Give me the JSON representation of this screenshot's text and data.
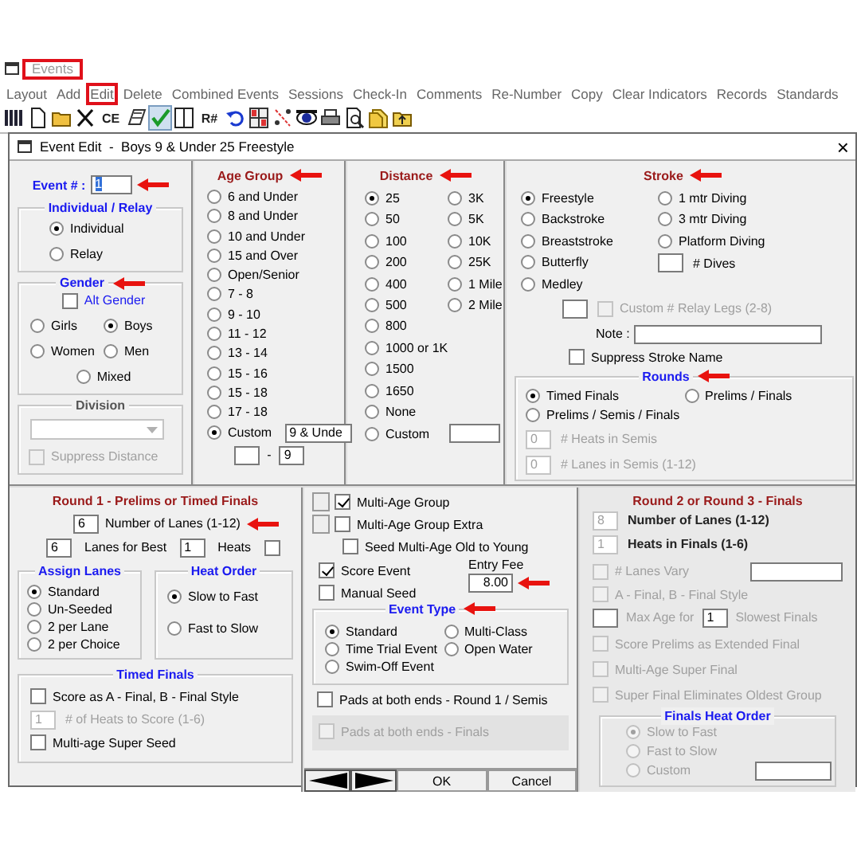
{
  "window": {
    "title": "Events",
    "highlighted": true
  },
  "menu": [
    {
      "label": "Layout",
      "highlighted": false
    },
    {
      "label": "Add",
      "highlighted": false
    },
    {
      "label": "Edit",
      "highlighted": true
    },
    {
      "label": "Delete",
      "highlighted": false
    },
    {
      "label": "Combined Events",
      "highlighted": false
    },
    {
      "label": "Sessions",
      "highlighted": false
    },
    {
      "label": "Check-In",
      "highlighted": false
    },
    {
      "label": "Comments",
      "highlighted": false
    },
    {
      "label": "Re-Number",
      "highlighted": false
    },
    {
      "label": "Copy",
      "highlighted": false
    },
    {
      "label": "Clear Indicators",
      "highlighted": false
    },
    {
      "label": "Records",
      "highlighted": false
    },
    {
      "label": "Standards",
      "highlighted": false
    }
  ],
  "toolbar": [
    {
      "kind": "columns",
      "pressed": false
    },
    {
      "kind": "page",
      "pressed": false
    },
    {
      "kind": "folder",
      "pressed": false
    },
    {
      "kind": "cross",
      "pressed": false
    },
    {
      "kind": "text",
      "label": "CE",
      "pressed": false
    },
    {
      "kind": "book",
      "pressed": false
    },
    {
      "kind": "check",
      "pressed": true
    },
    {
      "kind": "split",
      "pressed": false
    },
    {
      "kind": "text",
      "label": "R#",
      "pressed": false
    },
    {
      "kind": "undo",
      "pressed": false
    },
    {
      "kind": "grid",
      "pressed": false
    },
    {
      "kind": "scatter",
      "pressed": false
    },
    {
      "kind": "eye",
      "pressed": false
    },
    {
      "kind": "printer",
      "pressed": false
    },
    {
      "kind": "preview",
      "pressed": false
    },
    {
      "kind": "folders",
      "pressed": false
    },
    {
      "kind": "upload",
      "pressed": false
    }
  ],
  "dialog": {
    "title": "Event Edit  -  Boys 9 & Under 25 Freestyle",
    "close": "×"
  },
  "event_number": {
    "label": "Event # :",
    "value": "1",
    "arrow": true
  },
  "individual_relay": {
    "title": "Individual / Relay",
    "options": [
      {
        "label": "Individual",
        "selected": true
      },
      {
        "label": "Relay",
        "selected": false
      }
    ]
  },
  "gender": {
    "title": "Gender",
    "arrow": true,
    "alt_gender": {
      "label": "Alt Gender",
      "checked": false
    },
    "options": [
      {
        "label": "Girls",
        "selected": false
      },
      {
        "label": "Boys",
        "selected": true
      },
      {
        "label": "Women",
        "selected": false
      },
      {
        "label": "Men",
        "selected": false
      },
      {
        "label": "Mixed",
        "selected": false
      }
    ]
  },
  "division": {
    "title": "Division",
    "suppress_distance": {
      "label": "Suppress Distance",
      "checked": false,
      "disabled": true
    }
  },
  "age_group": {
    "title": "Age Group",
    "arrow": true,
    "options": [
      {
        "label": "6 and Under",
        "selected": false
      },
      {
        "label": "8 and Under",
        "selected": false
      },
      {
        "label": "10 and Under",
        "selected": false
      },
      {
        "label": "15 and Over",
        "selected": false
      },
      {
        "label": "Open/Senior",
        "selected": false
      },
      {
        "label": "7 - 8",
        "selected": false
      },
      {
        "label": "9 - 10",
        "selected": false
      },
      {
        "label": "11 - 12",
        "selected": false
      },
      {
        "label": "13 - 14",
        "selected": false
      },
      {
        "label": "15 - 16",
        "selected": false
      },
      {
        "label": "15 - 18",
        "selected": false
      },
      {
        "label": "17 - 18",
        "selected": false
      },
      {
        "label": "Custom",
        "selected": true
      }
    ],
    "custom_value": "9 & Unde",
    "range_separator": "-",
    "range_high": "9"
  },
  "distance": {
    "title": "Distance",
    "arrow": true,
    "column_1": [
      {
        "label": "25",
        "selected": true
      },
      {
        "label": "50",
        "selected": false
      },
      {
        "label": "100",
        "selected": false
      },
      {
        "label": "200",
        "selected": false
      },
      {
        "label": "400",
        "selected": false
      },
      {
        "label": "500",
        "selected": false
      },
      {
        "label": "800",
        "selected": false
      },
      {
        "label": "1000 or 1K",
        "selected": false
      },
      {
        "label": "1500",
        "selected": false
      },
      {
        "label": "1650",
        "selected": false
      },
      {
        "label": "None",
        "selected": false
      },
      {
        "label": "Custom",
        "selected": false
      }
    ],
    "column_2": [
      {
        "label": "3K",
        "selected": false
      },
      {
        "label": "5K",
        "selected": false
      },
      {
        "label": "10K",
        "selected": false
      },
      {
        "label": "25K",
        "selected": false
      },
      {
        "label": "1 Mile",
        "selected": false
      },
      {
        "label": "2 Mile",
        "selected": false
      }
    ]
  },
  "stroke": {
    "title": "Stroke",
    "arrow": true,
    "column_1": [
      {
        "label": "Freestyle",
        "selected": true
      },
      {
        "label": "Backstroke",
        "selected": false
      },
      {
        "label": "Breaststroke",
        "selected": false
      },
      {
        "label": "Butterfly",
        "selected": false
      },
      {
        "label": "Medley",
        "selected": false
      }
    ],
    "column_2": [
      {
        "label": "1 mtr Diving",
        "selected": false
      },
      {
        "label": "3 mtr Diving",
        "selected": false
      },
      {
        "label": "Platform Diving",
        "selected": false
      }
    ],
    "dives_label": "# Dives",
    "relay_legs": {
      "label": "Custom # Relay Legs (2-8)",
      "checked": false,
      "disabled": true
    },
    "note_label": "Note :",
    "suppress_stroke_name": {
      "label": "Suppress Stroke Name",
      "checked": false
    }
  },
  "rounds": {
    "title": "Rounds",
    "arrow": true,
    "options": [
      {
        "label": "Timed Finals",
        "selected": true
      },
      {
        "label": "Prelims / Finals",
        "selected": false
      },
      {
        "label": "Prelims / Semis / Finals",
        "selected": false
      }
    ],
    "heats_in_semis": {
      "value": "0",
      "label": "# Heats in Semis",
      "disabled": true
    },
    "lanes_in_semis": {
      "value": "0",
      "label": "# Lanes in Semis (1-12)",
      "disabled": true
    }
  },
  "round_1": {
    "title": "Round 1 - Prelims or Timed Finals",
    "lanes": {
      "value": "6",
      "label": "Number of Lanes (1-12)",
      "arrow": true
    },
    "lanes_for_best": {
      "value": "6",
      "label": "Lanes for Best"
    },
    "heats": {
      "value": "1",
      "label": "Heats",
      "checked": false
    },
    "assign_lanes": {
      "title": "Assign Lanes",
      "options": [
        {
          "label": "Standard",
          "selected": true
        },
        {
          "label": "Un-Seeded",
          "selected": false
        },
        {
          "label": "2 per Lane",
          "selected": false
        },
        {
          "label": "2 per Choice",
          "selected": false
        }
      ]
    },
    "heat_order": {
      "title": "Heat Order",
      "options": [
        {
          "label": "Slow to Fast",
          "selected": true
        },
        {
          "label": "Fast to Slow",
          "selected": false
        }
      ]
    },
    "timed_finals": {
      "title": "Timed Finals",
      "score_as_a_final": {
        "label": "Score as A - Final, B - Final Style",
        "checked": false
      },
      "heats_to_score": {
        "value": "1",
        "label": "# of Heats to Score (1-6)",
        "disabled": true
      },
      "multi_age_super_seed": {
        "label": "Multi-age Super Seed",
        "checked": false
      }
    }
  },
  "options": {
    "multi_age_group": {
      "label": "Multi-Age Group",
      "checked": true
    },
    "multi_age_group_extra": {
      "label": "Multi-Age Group Extra",
      "checked": false
    },
    "seed_multi_age": {
      "label": "Seed Multi-Age Old to Young",
      "checked": false
    },
    "score_event": {
      "label": "Score Event",
      "checked": true
    },
    "manual_seed": {
      "label": "Manual Seed",
      "checked": false
    },
    "entry_fee": {
      "label": "Entry Fee",
      "value": "8.00",
      "arrow": true
    },
    "event_type": {
      "title": "Event Type",
      "arrow": true,
      "options": [
        {
          "label": "Standard",
          "selected": true
        },
        {
          "label": "Time Trial Event",
          "selected": false
        },
        {
          "label": "Swim-Off Event",
          "selected": false
        },
        {
          "label": "Multi-Class",
          "selected": false
        },
        {
          "label": "Open Water",
          "selected": false
        }
      ]
    },
    "pads_round_1": {
      "label": "Pads at both ends - Round 1 / Semis",
      "checked": false,
      "disabled": false
    },
    "pads_finals": {
      "label": "Pads at both ends - Finals",
      "checked": false,
      "disabled": true
    }
  },
  "buttons": [
    {
      "kind": "previous"
    },
    {
      "kind": "next"
    },
    {
      "kind": "text",
      "label": "OK"
    },
    {
      "kind": "text",
      "label": "Cancel"
    }
  ],
  "round_2": {
    "title": "Round 2 or Round 3 - Finals",
    "lanes": {
      "value": "8",
      "label": "Number of Lanes (1-12)"
    },
    "heats": {
      "value": "1",
      "label": "Heats in Finals (1-6)"
    },
    "lanes_vary": {
      "label": "# Lanes Vary",
      "checked": false,
      "disabled": true
    },
    "a_final": {
      "label": "A - Final, B - Final Style",
      "checked": false,
      "disabled": true
    },
    "max_age": {
      "label": "Max Age for",
      "value": "1",
      "label_after": "Slowest Finals"
    },
    "score_prelims": {
      "label": "Score Prelims as Extended Final",
      "checked": false,
      "disabled": true
    },
    "multi_age_super_final": {
      "label": "Multi-Age Super Final",
      "checked": false,
      "disabled": true
    },
    "super_final_eliminates": {
      "label": "Super Final Eliminates Oldest Group",
      "checked": false,
      "disabled": true
    },
    "finals_heat_order": {
      "title": "Finals Heat Order",
      "disabled": true,
      "options": [
        {
          "label": "Slow to Fast",
          "selected": true
        },
        {
          "label": "Fast to Slow",
          "selected": false
        },
        {
          "label": "Custom",
          "selected": false
        }
      ]
    }
  }
}
